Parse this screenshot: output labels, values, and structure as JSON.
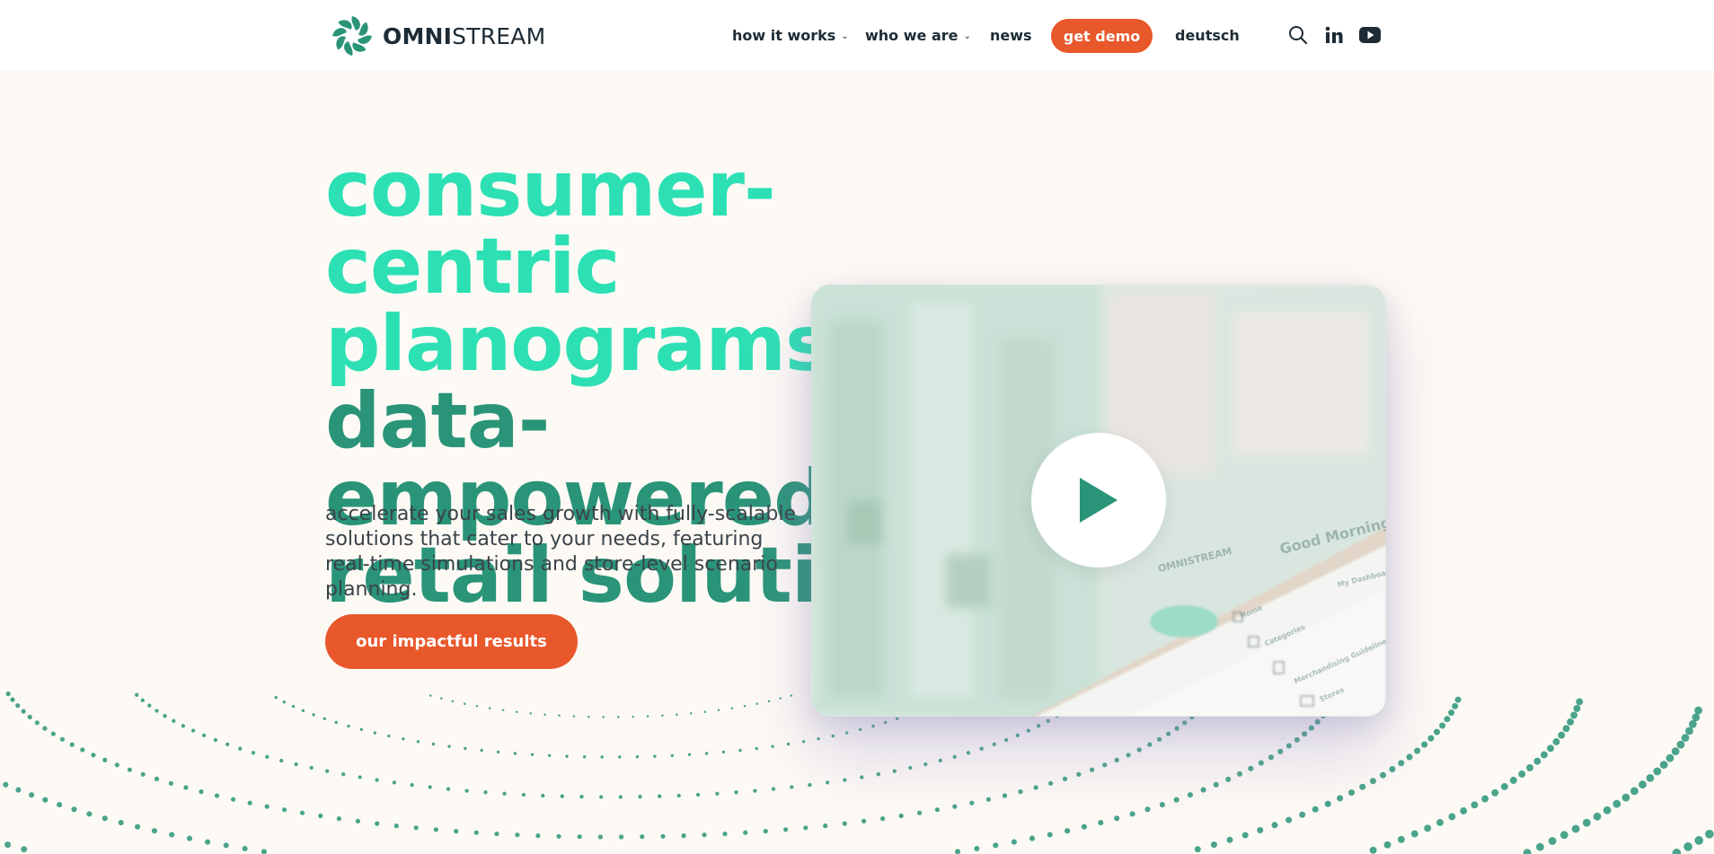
{
  "header": {
    "brand_bold": "OMNI",
    "brand_light": "STREAM",
    "nav": [
      {
        "label": "how it works"
      },
      {
        "label": "who we are"
      },
      {
        "label": "news"
      },
      {
        "label": "deutsch"
      }
    ],
    "demo_label": "get demo"
  },
  "hero": {
    "title_accent": "consumer-centric planograms",
    "title_dark": " via data-empowered retail solutions.",
    "subtitle": "accelerate your sales growth with fully-scalable solutions that cater to your needs, featuring real-time simulations and store-level scenario planning.",
    "cta_label": "our impactful results"
  },
  "video": {
    "greeting": "Good Morning",
    "brand": "OMNISTREAM",
    "dashboard": "My Dashboard",
    "menu": [
      "Home",
      "Categories",
      "Merchandising Guidelines",
      "Stores"
    ]
  },
  "colors": {
    "accent": "#2de0b4",
    "dark_green": "#2a9478",
    "orange": "#e8582b",
    "text": "#1d2b35",
    "background": "#fdfaf5"
  },
  "icons": [
    "search-icon",
    "linkedin-icon",
    "youtube-icon",
    "play-icon",
    "chevron-down-icon"
  ]
}
